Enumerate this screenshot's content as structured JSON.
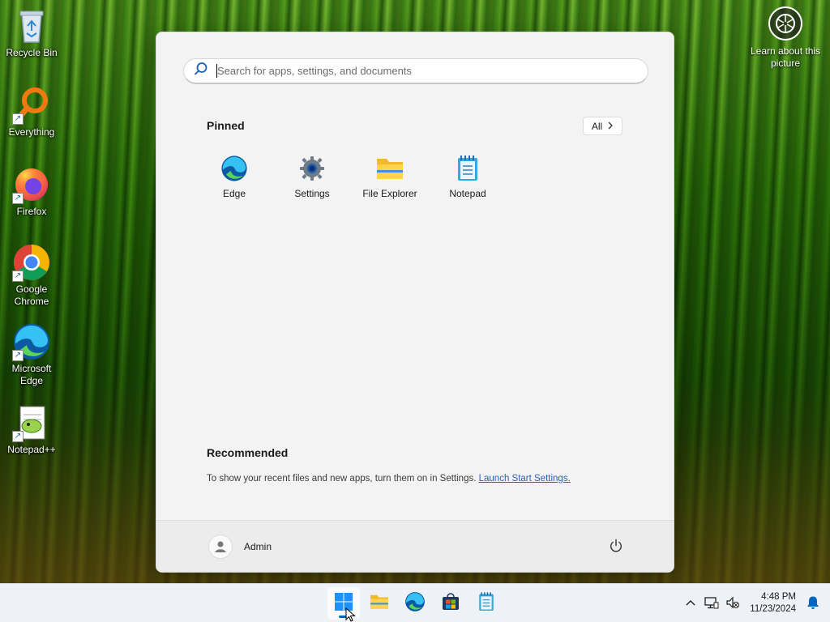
{
  "desktop": {
    "icons": [
      {
        "label": "Recycle Bin",
        "icon": "recycle-bin-icon"
      },
      {
        "label": "Everything",
        "icon": "everything-icon"
      },
      {
        "label": "Firefox",
        "icon": "firefox-icon"
      },
      {
        "label": "Google Chrome",
        "icon": "chrome-icon"
      },
      {
        "label": "Microsoft Edge",
        "icon": "edge-icon"
      },
      {
        "label": "Notepad++",
        "icon": "notepad-plus-plus-icon"
      }
    ],
    "learn_label": "Learn about this picture"
  },
  "start_menu": {
    "search_placeholder": "Search for apps, settings, and documents",
    "pinned_title": "Pinned",
    "all_label": "All",
    "pinned": [
      {
        "label": "Edge",
        "icon": "edge-icon"
      },
      {
        "label": "Settings",
        "icon": "settings-gear-icon"
      },
      {
        "label": "File Explorer",
        "icon": "file-explorer-icon"
      },
      {
        "label": "Notepad",
        "icon": "notepad-icon"
      }
    ],
    "recommended_title": "Recommended",
    "recommended_text": "To show your recent files and new apps, turn them on in Settings.",
    "recommended_link": "Launch Start Settings.",
    "user_name": "Admin"
  },
  "taskbar": {
    "apps": [
      {
        "icon": "windows-start-icon",
        "active": true
      },
      {
        "icon": "file-explorer-icon"
      },
      {
        "icon": "edge-icon"
      },
      {
        "icon": "microsoft-store-icon"
      },
      {
        "icon": "notepad-icon"
      }
    ],
    "time": "4:48 PM",
    "date": "11/23/2024"
  },
  "colors": {
    "accent": "#0067c0",
    "link": "#2b5fbd"
  }
}
